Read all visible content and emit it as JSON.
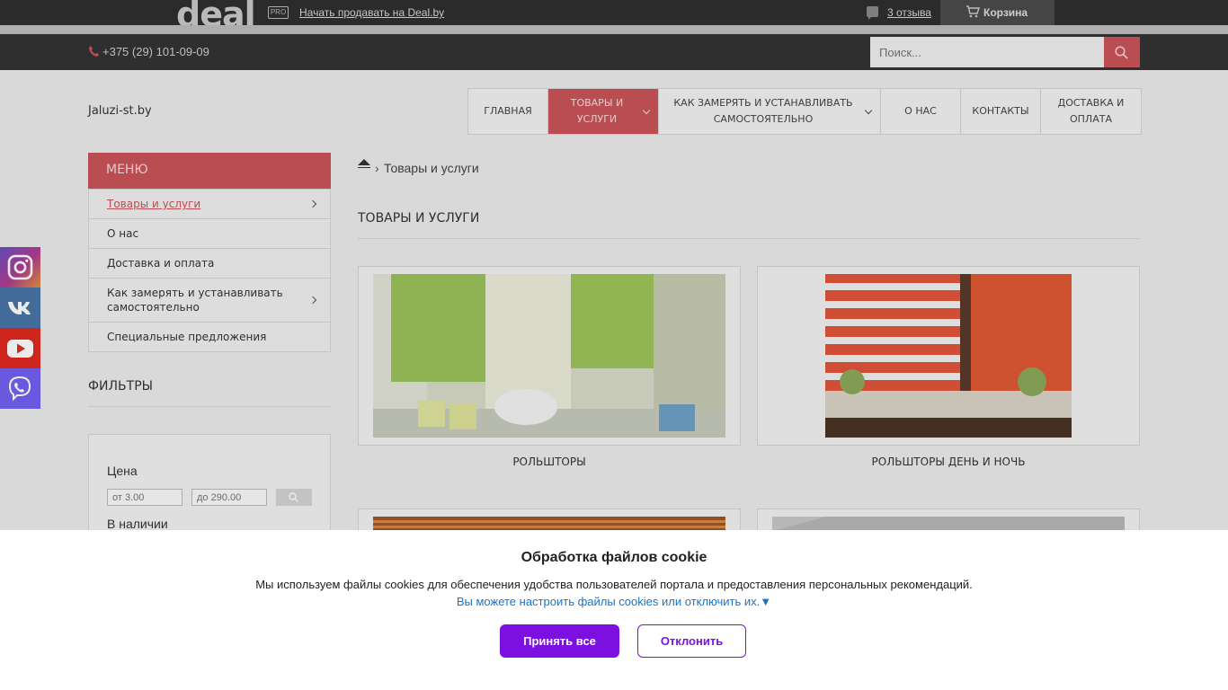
{
  "topbar": {
    "logo": "deal",
    "pro_badge": "PRO",
    "sell_link": "Начать продавать на Deal.by",
    "reviews_link": "3 отзыва",
    "cart_label": "Корзина"
  },
  "header": {
    "phone": "+375 (29) 101-09-09",
    "search_placeholder": "Поиск..."
  },
  "site": {
    "name": "Jaluzi-st.by"
  },
  "nav": {
    "items": [
      {
        "label": "Главная"
      },
      {
        "label": "Товары и услуги"
      },
      {
        "label": "Как замерять и устанавливать самостоятельно"
      },
      {
        "label": "О нас"
      },
      {
        "label": "Контакты"
      },
      {
        "label": "Доставка и оплата"
      }
    ]
  },
  "sidebar": {
    "menu_title": "МЕНЮ",
    "items": [
      {
        "label": "Товары и услуги"
      },
      {
        "label": "О нас"
      },
      {
        "label": "Доставка и оплата"
      },
      {
        "label": "Как замерять и устанавливать самостоятельно"
      },
      {
        "label": "Специальные предложения"
      }
    ],
    "filters_title": "ФИЛЬТРЫ",
    "price_label": "Цена",
    "price_from_placeholder": "от 3.00",
    "price_to_placeholder": "до 290.00",
    "stock_label": "В наличии"
  },
  "social": [
    "instagram-icon",
    "vk-icon",
    "youtube-icon",
    "viber-icon"
  ],
  "main": {
    "breadcrumb_sep": "›",
    "breadcrumb_current": "Товары и услуги",
    "title": "Товары и услуги",
    "products": [
      {
        "name": "Рольшторы"
      },
      {
        "name": "Рольшторы день и ночь"
      }
    ]
  },
  "cookie": {
    "title": "Обработка файлов cookie",
    "text": "Мы используем файлы cookies для обеспечения удобства пользователей портала и предоставления персональных рекомендаций.",
    "settings_link": "Вы можете настроить файлы cookies или отключить их.▼",
    "accept_label": "Принять все",
    "decline_label": "Отклонить"
  },
  "colors": {
    "accent": "#c9545a",
    "cookie_button": "#7b10e0",
    "instagram": "#b23d8f",
    "vk": "#4a76a8",
    "youtube": "#e02a20",
    "viber": "#7360f2"
  }
}
